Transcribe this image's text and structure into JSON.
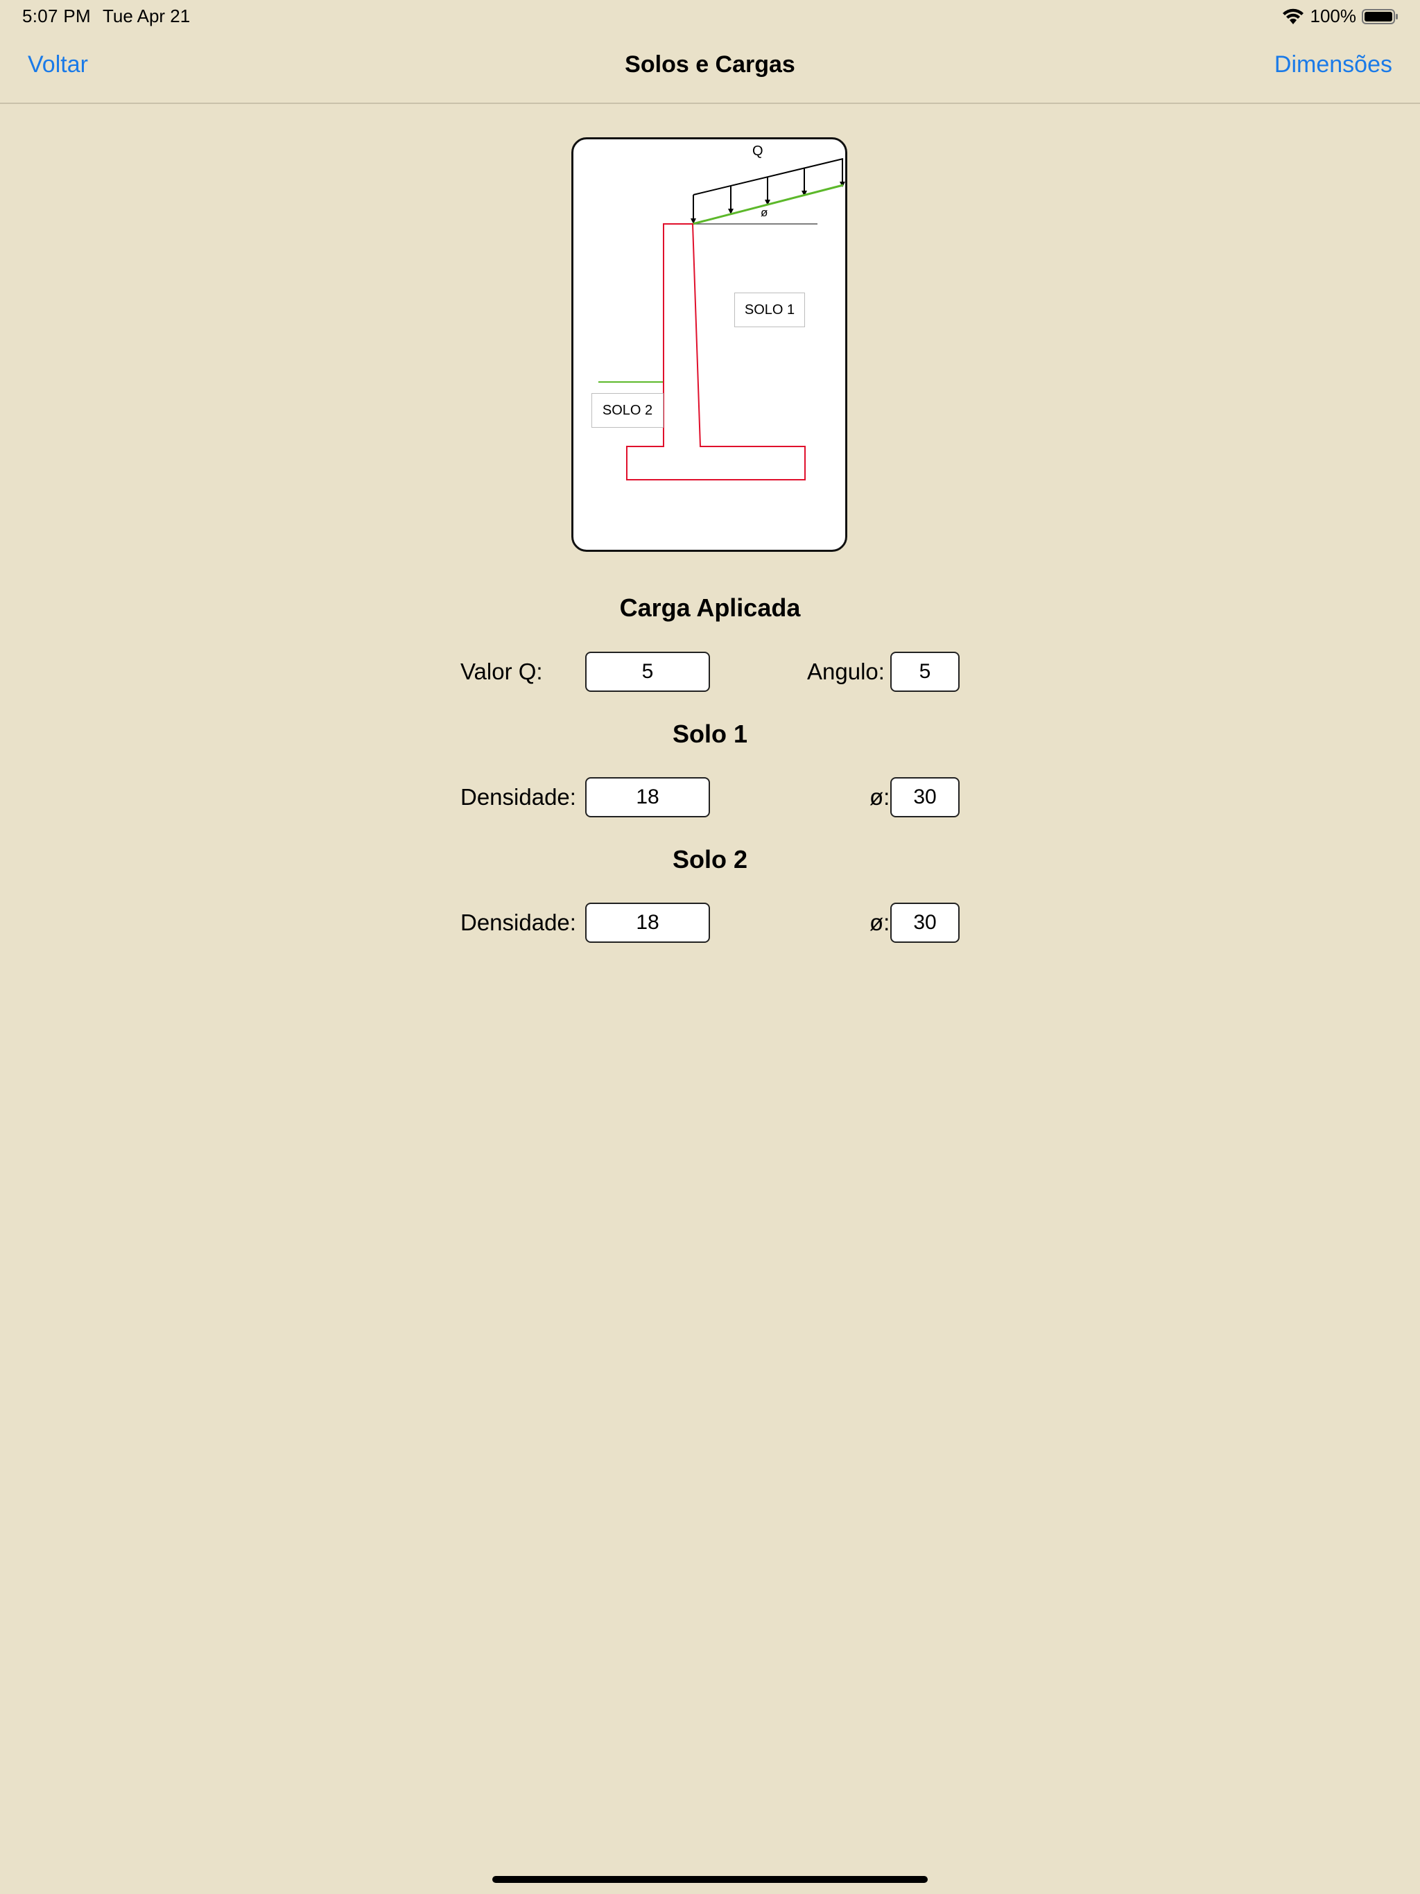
{
  "status": {
    "time": "5:07 PM",
    "date": "Tue Apr 21",
    "battery": "100%"
  },
  "nav": {
    "back_label": "Voltar",
    "title": "Solos e Cargas",
    "forward_label": "Dimensões"
  },
  "diagram": {
    "load_label": "Q",
    "angle_label": "ø",
    "solo1_label": "SOLO 1",
    "solo2_label": "SOLO 2",
    "wall_color": "#e0102c",
    "ground_color": "#5cb82a"
  },
  "carga": {
    "title": "Carga Aplicada",
    "q_label": "Valor Q:",
    "q_value": "5",
    "angle_label": "Angulo:",
    "angle_value": "5"
  },
  "solo1": {
    "title": "Solo 1",
    "density_label": "Densidade:",
    "density_value": "18",
    "phi_label": "ø:",
    "phi_value": "30"
  },
  "solo2": {
    "title": "Solo 2",
    "density_label": "Densidade:",
    "density_value": "18",
    "phi_label": "ø:",
    "phi_value": "30"
  }
}
